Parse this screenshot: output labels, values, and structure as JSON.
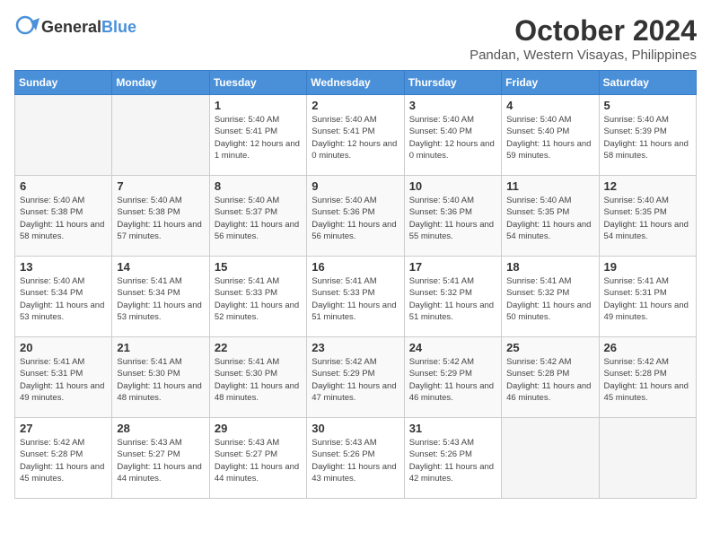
{
  "logo": {
    "general": "General",
    "blue": "Blue"
  },
  "header": {
    "month": "October 2024",
    "location": "Pandan, Western Visayas, Philippines"
  },
  "weekdays": [
    "Sunday",
    "Monday",
    "Tuesday",
    "Wednesday",
    "Thursday",
    "Friday",
    "Saturday"
  ],
  "weeks": [
    [
      {
        "day": null
      },
      {
        "day": null
      },
      {
        "day": 1,
        "sunrise": "5:40 AM",
        "sunset": "5:41 PM",
        "daylight": "12 hours and 1 minute."
      },
      {
        "day": 2,
        "sunrise": "5:40 AM",
        "sunset": "5:41 PM",
        "daylight": "12 hours and 0 minutes."
      },
      {
        "day": 3,
        "sunrise": "5:40 AM",
        "sunset": "5:40 PM",
        "daylight": "12 hours and 0 minutes."
      },
      {
        "day": 4,
        "sunrise": "5:40 AM",
        "sunset": "5:40 PM",
        "daylight": "11 hours and 59 minutes."
      },
      {
        "day": 5,
        "sunrise": "5:40 AM",
        "sunset": "5:39 PM",
        "daylight": "11 hours and 58 minutes."
      }
    ],
    [
      {
        "day": 6,
        "sunrise": "5:40 AM",
        "sunset": "5:38 PM",
        "daylight": "11 hours and 58 minutes."
      },
      {
        "day": 7,
        "sunrise": "5:40 AM",
        "sunset": "5:38 PM",
        "daylight": "11 hours and 57 minutes."
      },
      {
        "day": 8,
        "sunrise": "5:40 AM",
        "sunset": "5:37 PM",
        "daylight": "11 hours and 56 minutes."
      },
      {
        "day": 9,
        "sunrise": "5:40 AM",
        "sunset": "5:36 PM",
        "daylight": "11 hours and 56 minutes."
      },
      {
        "day": 10,
        "sunrise": "5:40 AM",
        "sunset": "5:36 PM",
        "daylight": "11 hours and 55 minutes."
      },
      {
        "day": 11,
        "sunrise": "5:40 AM",
        "sunset": "5:35 PM",
        "daylight": "11 hours and 54 minutes."
      },
      {
        "day": 12,
        "sunrise": "5:40 AM",
        "sunset": "5:35 PM",
        "daylight": "11 hours and 54 minutes."
      }
    ],
    [
      {
        "day": 13,
        "sunrise": "5:40 AM",
        "sunset": "5:34 PM",
        "daylight": "11 hours and 53 minutes."
      },
      {
        "day": 14,
        "sunrise": "5:41 AM",
        "sunset": "5:34 PM",
        "daylight": "11 hours and 53 minutes."
      },
      {
        "day": 15,
        "sunrise": "5:41 AM",
        "sunset": "5:33 PM",
        "daylight": "11 hours and 52 minutes."
      },
      {
        "day": 16,
        "sunrise": "5:41 AM",
        "sunset": "5:33 PM",
        "daylight": "11 hours and 51 minutes."
      },
      {
        "day": 17,
        "sunrise": "5:41 AM",
        "sunset": "5:32 PM",
        "daylight": "11 hours and 51 minutes."
      },
      {
        "day": 18,
        "sunrise": "5:41 AM",
        "sunset": "5:32 PM",
        "daylight": "11 hours and 50 minutes."
      },
      {
        "day": 19,
        "sunrise": "5:41 AM",
        "sunset": "5:31 PM",
        "daylight": "11 hours and 49 minutes."
      }
    ],
    [
      {
        "day": 20,
        "sunrise": "5:41 AM",
        "sunset": "5:31 PM",
        "daylight": "11 hours and 49 minutes."
      },
      {
        "day": 21,
        "sunrise": "5:41 AM",
        "sunset": "5:30 PM",
        "daylight": "11 hours and 48 minutes."
      },
      {
        "day": 22,
        "sunrise": "5:41 AM",
        "sunset": "5:30 PM",
        "daylight": "11 hours and 48 minutes."
      },
      {
        "day": 23,
        "sunrise": "5:42 AM",
        "sunset": "5:29 PM",
        "daylight": "11 hours and 47 minutes."
      },
      {
        "day": 24,
        "sunrise": "5:42 AM",
        "sunset": "5:29 PM",
        "daylight": "11 hours and 46 minutes."
      },
      {
        "day": 25,
        "sunrise": "5:42 AM",
        "sunset": "5:28 PM",
        "daylight": "11 hours and 46 minutes."
      },
      {
        "day": 26,
        "sunrise": "5:42 AM",
        "sunset": "5:28 PM",
        "daylight": "11 hours and 45 minutes."
      }
    ],
    [
      {
        "day": 27,
        "sunrise": "5:42 AM",
        "sunset": "5:28 PM",
        "daylight": "11 hours and 45 minutes."
      },
      {
        "day": 28,
        "sunrise": "5:43 AM",
        "sunset": "5:27 PM",
        "daylight": "11 hours and 44 minutes."
      },
      {
        "day": 29,
        "sunrise": "5:43 AM",
        "sunset": "5:27 PM",
        "daylight": "11 hours and 44 minutes."
      },
      {
        "day": 30,
        "sunrise": "5:43 AM",
        "sunset": "5:26 PM",
        "daylight": "11 hours and 43 minutes."
      },
      {
        "day": 31,
        "sunrise": "5:43 AM",
        "sunset": "5:26 PM",
        "daylight": "11 hours and 42 minutes."
      },
      {
        "day": null
      },
      {
        "day": null
      }
    ]
  ],
  "labels": {
    "sunrise": "Sunrise:",
    "sunset": "Sunset:",
    "daylight": "Daylight:"
  }
}
